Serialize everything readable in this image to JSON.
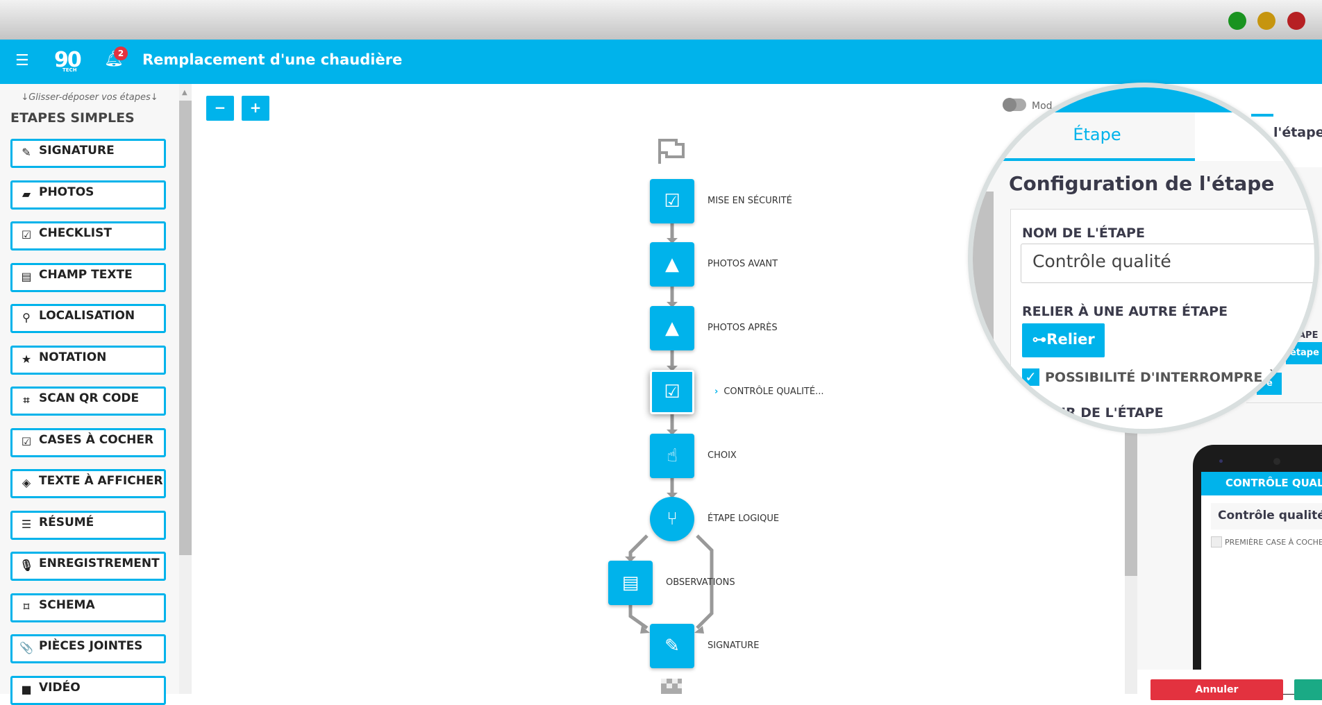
{
  "window": {
    "controls": [
      "green",
      "yellow",
      "red"
    ],
    "colors": {
      "green": "#1a9320",
      "yellow": "#c6950f",
      "red": "#b62023"
    }
  },
  "header": {
    "menu_icon": "hamburger-icon",
    "logo": "90 TECH",
    "notification_count": "2",
    "title": "Remplacement d'une chaudière",
    "accent": "#00b3eb"
  },
  "sidebar": {
    "hint": "↓Glisser-déposer vos étapes↓",
    "section_title": "ETAPES SIMPLES",
    "items": [
      {
        "label": "SIGNATURE",
        "icon": "✎"
      },
      {
        "label": "PHOTOS",
        "icon": "▰"
      },
      {
        "label": "CHECKLIST",
        "icon": "☑"
      },
      {
        "label": "CHAMP TEXTE",
        "icon": "▤"
      },
      {
        "label": "LOCALISATION",
        "icon": "⚲"
      },
      {
        "label": "NOTATION",
        "icon": "★"
      },
      {
        "label": "SCAN QR CODE",
        "icon": "⌗"
      },
      {
        "label": "CASES À COCHER",
        "icon": "☑"
      },
      {
        "label": "TEXTE À AFFICHER",
        "icon": "◈"
      },
      {
        "label": "RÉSUMÉ",
        "icon": "☰"
      },
      {
        "label": "ENREGISTREMENT",
        "icon": "🎙"
      },
      {
        "label": "SCHEMA",
        "icon": "⌑"
      },
      {
        "label": "PIÈCES JOINTES",
        "icon": "📎"
      },
      {
        "label": "VIDÉO",
        "icon": "■"
      }
    ]
  },
  "zoom": {
    "minus": "−",
    "plus": "+"
  },
  "flow": {
    "nodes": [
      {
        "label": "MISE EN SÉCURITÉ",
        "icon": "☑"
      },
      {
        "label": "PHOTOS AVANT",
        "icon": "▲"
      },
      {
        "label": "PHOTOS APRÈS",
        "icon": "▲"
      },
      {
        "label": "CONTRÔLE QUALITÉ...",
        "icon": "☑",
        "selected": true
      },
      {
        "label": "CHOIX",
        "icon": "☝"
      },
      {
        "label": "ÉTAPE LOGIQUE",
        "icon": "⑂"
      },
      {
        "label": "OBSERVATIONS",
        "icon": "▤"
      },
      {
        "label": "SIGNATURE",
        "icon": "✎"
      }
    ]
  },
  "panel": {
    "mode_label": "Mod",
    "tab_active": "Étape",
    "tab_other_partial": "l'étape",
    "config_title": "Configuration de l'étape",
    "name_label": "NOM DE L'ÉTAPE",
    "name_value": "Contrôle qualité",
    "link_label": "RELIER À UNE AUTRE ÉTAPE",
    "link_button": "⊶Relier",
    "interrupt_label": "POSSIBILITÉ D'INTERROMPRE À CET",
    "interrupt_checked": true,
    "color_label": "COULEUR DE L'ÉTAPE",
    "bg_partial_label": "APE",
    "bg_partial_button": "étape",
    "bg_partial_button2": "e"
  },
  "phone": {
    "header": "CONTRÔLE QUALITÉ",
    "step_name": "Contrôle qualité",
    "checkbox_label": "PREMIÈRE CASE À COCHER"
  },
  "actions": {
    "cancel": "Annuler"
  }
}
